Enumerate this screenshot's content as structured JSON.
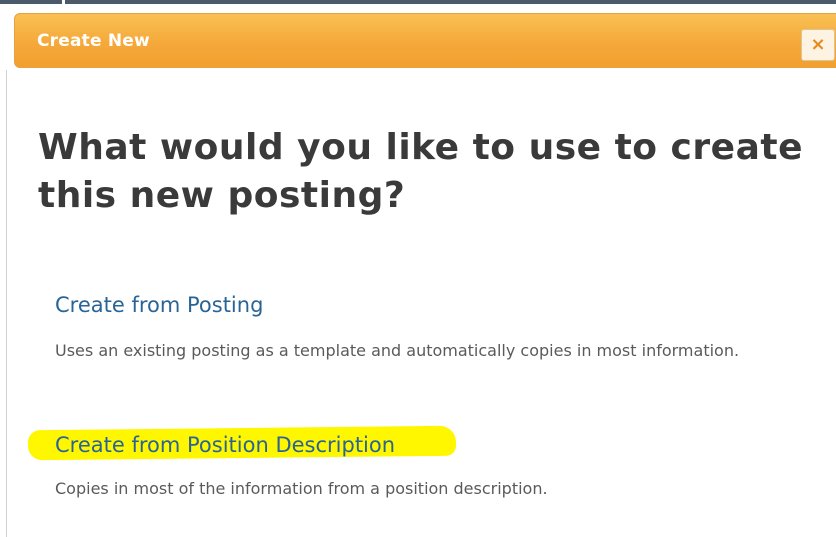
{
  "dialog": {
    "title": "Create New",
    "close_label": "×"
  },
  "heading": "What would you like to use to create this new posting?",
  "options": [
    {
      "label": "Create from Posting",
      "description": "Uses an existing posting as a template and automatically copies in most information.",
      "highlighted": false
    },
    {
      "label": "Create from Position Description",
      "description": "Copies in most of the information from a position description.",
      "highlighted": true
    }
  ],
  "colors": {
    "header_orange": "#f5a93a",
    "link_blue": "#2a6496",
    "highlight_yellow": "#fff700",
    "heading_text": "#3a3a3a",
    "body_text": "#5a5a5a"
  }
}
